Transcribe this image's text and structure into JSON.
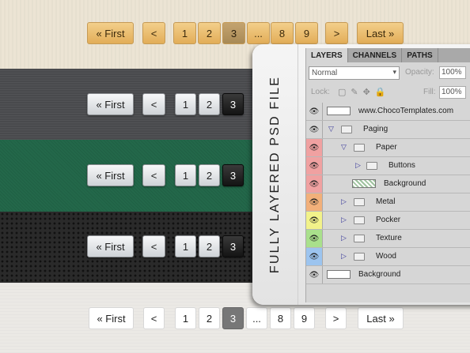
{
  "pagination": {
    "first": "« First",
    "prev": "<",
    "next": ">",
    "last": "Last »",
    "ellipsis": "...",
    "pages": [
      "1",
      "2",
      "3",
      "8",
      "9"
    ]
  },
  "ps_panel": {
    "side_text": "FULLY LAYERED PSD FILE",
    "tabs": [
      "LAYERS",
      "CHANNELS",
      "PATHS"
    ],
    "blend_mode": "Normal",
    "opacity_label": "Opacity:",
    "opacity_value": "100%",
    "lock_label": "Lock:",
    "fill_label": "Fill:",
    "fill_value": "100%",
    "layers": [
      {
        "name": "www.ChocoTemplates.com",
        "color": ""
      },
      {
        "name": "Paging",
        "color": ""
      },
      {
        "name": "Paper",
        "color": "#f0a1a1"
      },
      {
        "name": "Buttons",
        "color": "#f0a1a1"
      },
      {
        "name": "Background",
        "color": "#f0a1a1"
      },
      {
        "name": "Metal",
        "color": "#f2b07a"
      },
      {
        "name": "Pocker",
        "color": "#f2f28a"
      },
      {
        "name": "Texture",
        "color": "#a9e08c"
      },
      {
        "name": "Wood",
        "color": "#9cc4ef"
      },
      {
        "name": "Background",
        "color": ""
      }
    ]
  }
}
